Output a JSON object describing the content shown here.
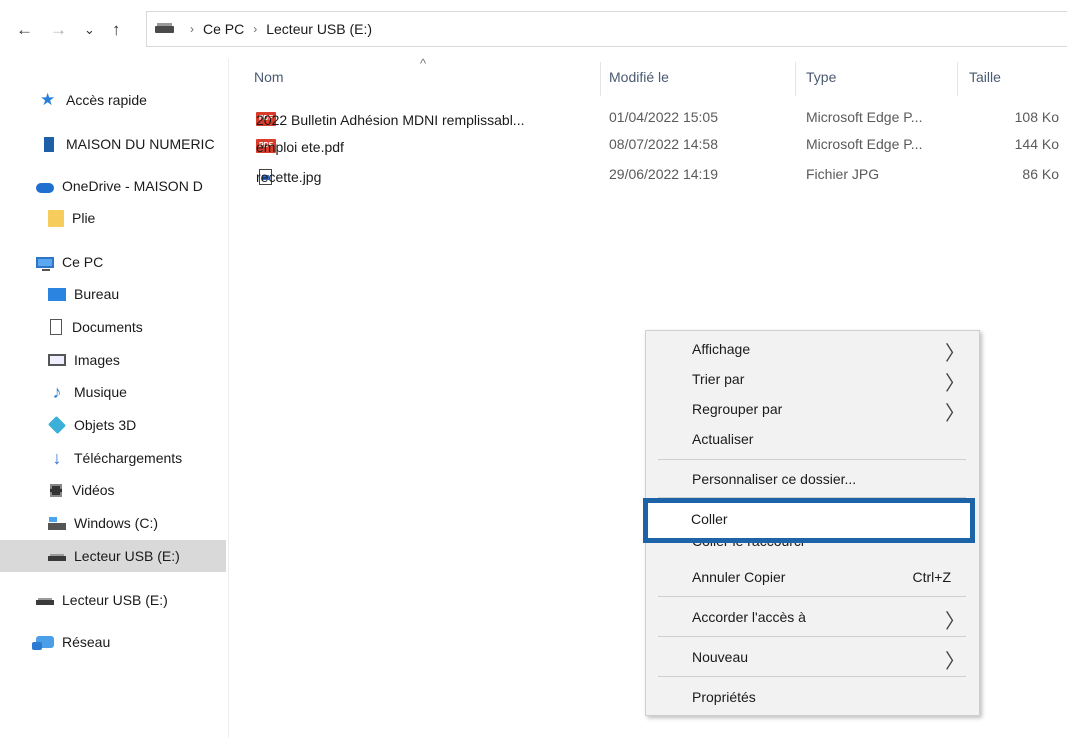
{
  "nav": {
    "back": "←",
    "forward": "→",
    "recent": "⌄",
    "up": "↑",
    "breadcrumb": [
      "Ce PC",
      "Lecteur USB (E:)"
    ]
  },
  "sidebar": {
    "items": [
      {
        "label": "Accès rapide",
        "icon": "star-icon"
      },
      {
        "label": "MAISON DU NUMERIC",
        "icon": "building-icon"
      },
      {
        "label": "OneDrive - MAISON D",
        "icon": "cloud-icon"
      },
      {
        "label": "Plie",
        "icon": "folder-icon"
      },
      {
        "label": "Ce PC",
        "icon": "computer-icon"
      },
      {
        "label": "Bureau",
        "icon": "desktop-icon"
      },
      {
        "label": "Documents",
        "icon": "documents-icon"
      },
      {
        "label": "Images",
        "icon": "images-icon"
      },
      {
        "label": "Musique",
        "icon": "music-icon"
      },
      {
        "label": "Objets 3D",
        "icon": "cube-icon"
      },
      {
        "label": "Téléchargements",
        "icon": "download-icon"
      },
      {
        "label": "Vidéos",
        "icon": "video-icon"
      },
      {
        "label": "Windows (C:)",
        "icon": "windows-drive-icon"
      },
      {
        "label": "Lecteur USB (E:)",
        "icon": "usb-drive-icon",
        "selected": true
      },
      {
        "label": "Lecteur USB (E:)",
        "icon": "usb-drive-icon"
      },
      {
        "label": "Réseau",
        "icon": "network-icon"
      }
    ]
  },
  "columns": {
    "name": "Nom",
    "modified": "Modifié le",
    "type": "Type",
    "size": "Taille"
  },
  "files": [
    {
      "name": "2022 Bulletin Adhésion MDNI remplissabl...",
      "modified": "01/04/2022 15:05",
      "type": "Microsoft Edge P...",
      "size": "108 Ko",
      "icon": "pdf-icon",
      "icon_text": "PDF"
    },
    {
      "name": "emploi ete.pdf",
      "modified": "08/07/2022 14:58",
      "type": "Microsoft Edge P...",
      "size": "144 Ko",
      "icon": "pdf-icon",
      "icon_text": "PDF"
    },
    {
      "name": "recette.jpg",
      "modified": "29/06/2022 14:19",
      "type": "Fichier JPG",
      "size": "86 Ko",
      "icon": "jpg-icon"
    }
  ],
  "context_menu": {
    "affichage": "Affichage",
    "trier": "Trier par",
    "regrouper": "Regrouper par",
    "actualiser": "Actualiser",
    "personnaliser": "Personnaliser ce dossier...",
    "coller": "Coller",
    "coller_raccourci": "Coller le raccourci",
    "annuler": "Annuler Copier",
    "annuler_shortcut": "Ctrl+Z",
    "accorder": "Accorder l'accès à",
    "nouveau": "Nouveau",
    "proprietes": "Propriétés",
    "submenu_arrow": "〉"
  },
  "colors": {
    "highlight_border": "#1c63a8",
    "selected_nav": "#d9d9d9",
    "menu_bg": "#f2f2f2"
  }
}
